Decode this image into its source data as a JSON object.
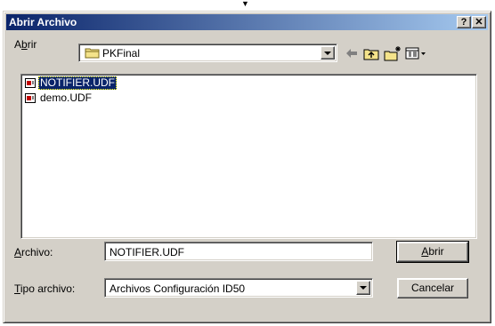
{
  "dialog": {
    "title": "Abrir Archivo",
    "help_label": "?",
    "close_label": "✕"
  },
  "look_in": {
    "label_prefix": "A",
    "label_mnemonic": "b",
    "label_suffix": "rir",
    "folder": "PKFinal"
  },
  "toolbar": {
    "back": "back-arrow-icon",
    "up": "folder-up-icon",
    "new_folder": "new-folder-icon",
    "view_menu": "view-menu-icon"
  },
  "files": [
    {
      "name": "NOTIFIER.UDF",
      "selected": true
    },
    {
      "name": "demo.UDF",
      "selected": false
    }
  ],
  "filename": {
    "label_mnemonic": "A",
    "label_rest": "rchivo:",
    "value": "NOTIFIER.UDF"
  },
  "filetype": {
    "label_mnemonic": "T",
    "label_rest": "ipo archivo:",
    "value": "Archivos Configuración ID50"
  },
  "buttons": {
    "open_mnemonic": "A",
    "open_rest": "brir",
    "cancel": "Cancelar"
  },
  "colors": {
    "face": "#d4d0c8",
    "title_start": "#0a246a",
    "title_end": "#a6caf0",
    "selection": "#0a246a"
  }
}
